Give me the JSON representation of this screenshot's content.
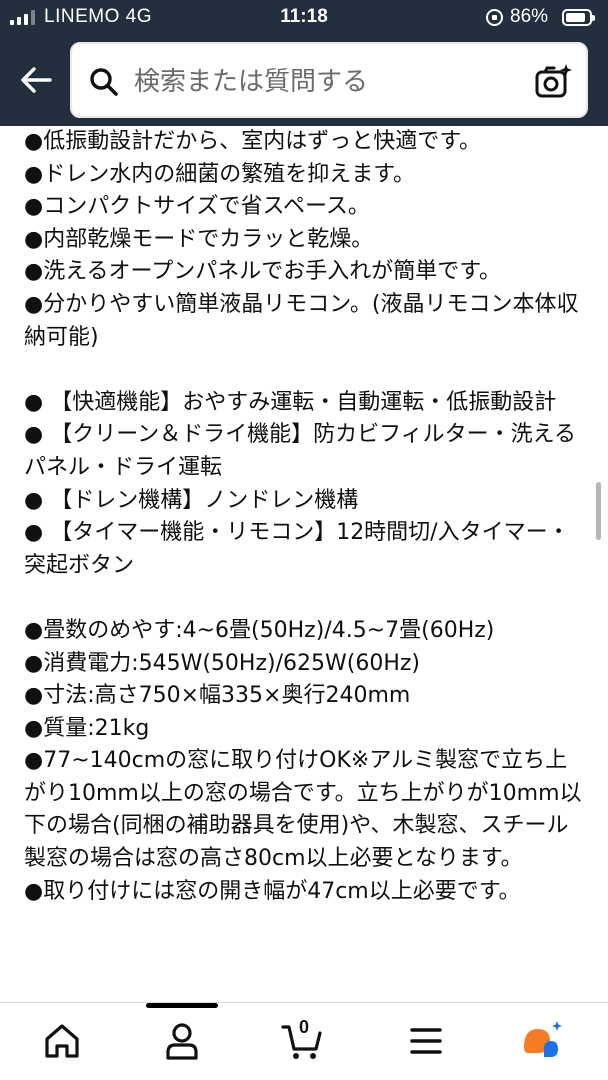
{
  "status_bar": {
    "carrier": "LINEMO  4G",
    "time": "11:18",
    "battery_percent": "86%",
    "battery_level": 0.86,
    "signal_bars_active": 3,
    "signal_bars_total": 4
  },
  "header": {
    "back_icon": "arrow-left-icon",
    "search_placeholder": "検索または質問する",
    "search_icon": "search-icon",
    "camera_icon": "camera-sparkle-icon"
  },
  "content": {
    "lines": [
      "●低振動設計だから、室内はずっと快適です。",
      "●ドレン水内の細菌の繁殖を抑えます。",
      "●コンパクトサイズで省スペース。",
      "●内部乾燥モードでカラッと乾燥。",
      "●洗えるオープンパネルでお手入れが簡単です。",
      "●分かりやすい簡単液晶リモコン。(液晶リモコン本体収納可能)",
      "",
      "● 【快適機能】おやすみ運転・自動運転・低振動設計",
      "● 【クリーン＆ドライ機能】防カビフィルター・洗えるパネル・ドライ運転",
      "● 【ドレン機構】ノンドレン機構",
      "● 【タイマー機能・リモコン】12時間切/入タイマー・突起ボタン",
      "",
      "●畳数のめやす:4~6畳(50Hz)/4.5~7畳(60Hz)",
      "●消費電力:545W(50Hz)/625W(60Hz)",
      "●寸法:高さ750×幅335×奥行240mm",
      "●質量:21kg",
      "●77~140cmの窓に取り付けOK※アルミ製窓で立ち上がり10mm以上の窓の場合です。立ち上がりが10mm以下の場合(同梱の補助器具を使用)や、木製窓、スチール製窓の場合は窓の高さ80cm以上必要となります。",
      "●取り付けには窓の開き幅が47cm以上必要です。"
    ]
  },
  "bottom_nav": {
    "items": [
      {
        "icon": "home-icon"
      },
      {
        "icon": "account-icon"
      },
      {
        "icon": "cart-icon",
        "count": "0"
      },
      {
        "icon": "menu-icon"
      },
      {
        "icon": "rufus-ai-icon"
      }
    ]
  },
  "colors": {
    "header_bg": "#232f3e",
    "text": "#0f1111",
    "ai_orange": "#f57c22",
    "ai_blue": "#1a73e8"
  }
}
